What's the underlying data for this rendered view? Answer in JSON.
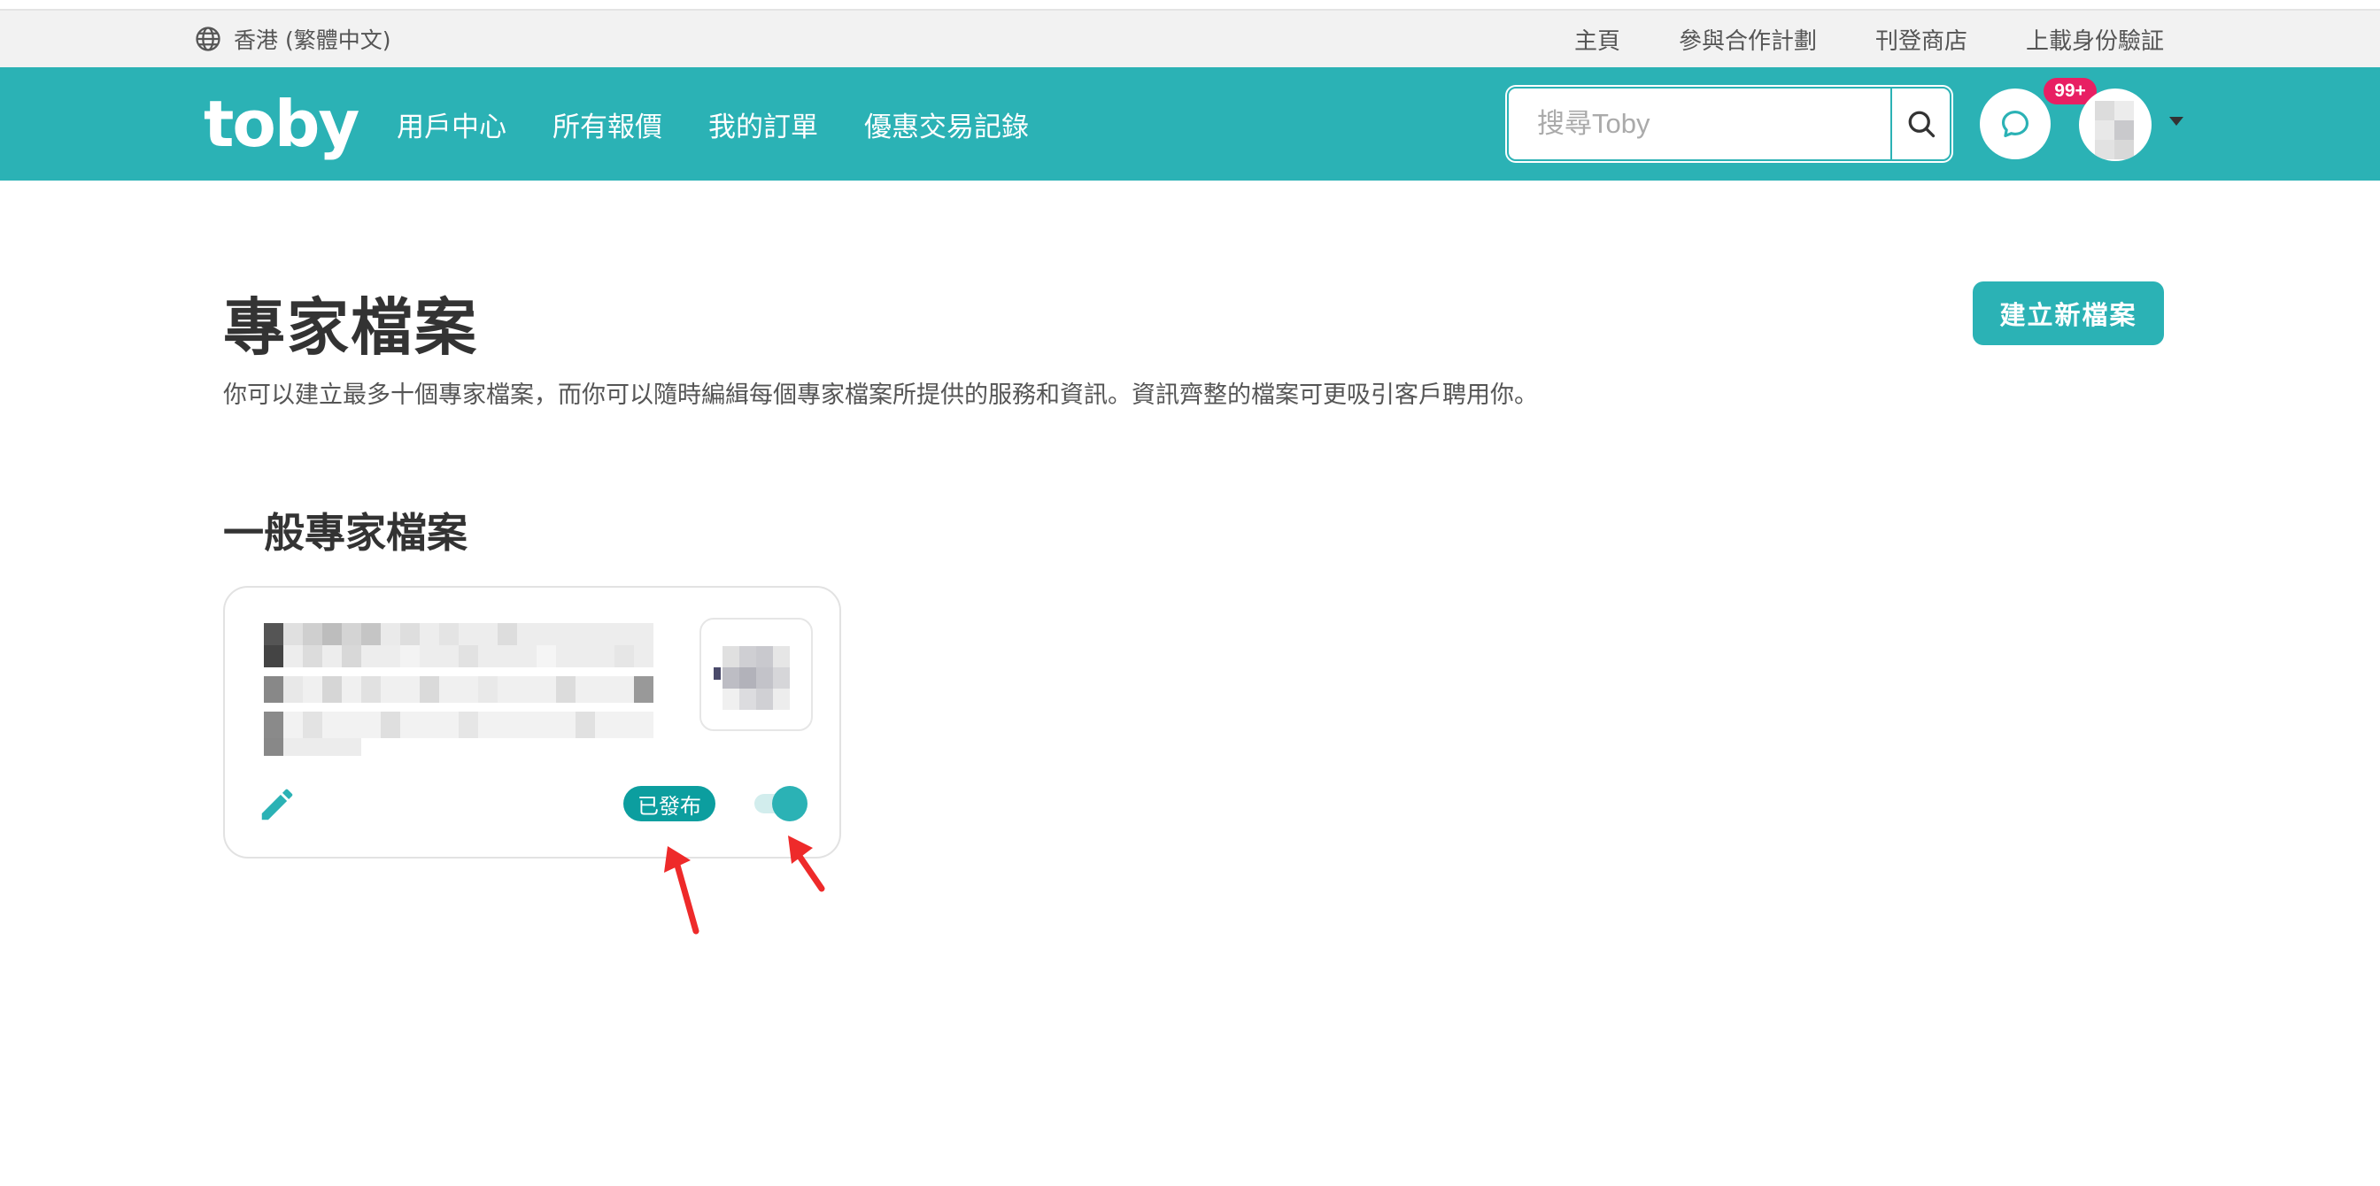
{
  "topbar": {
    "locale": "香港 (繁體中文)",
    "links": [
      "主頁",
      "參與合作計劃",
      "刊登商店",
      "上載身份驗証"
    ]
  },
  "navbar": {
    "logo": "toby",
    "links": [
      "用戶中心",
      "所有報價",
      "我的訂單",
      "優惠交易記錄"
    ],
    "search_placeholder": "搜尋Toby",
    "notification_count": "99+"
  },
  "main": {
    "title": "專家檔案",
    "description": "你可以建立最多十個專家檔案，而你可以隨時編緝每個專家檔案所提供的服務和資訊。資訊齊整的檔案可更吸引客戶聘用你。",
    "new_button": "建立新檔案",
    "section_title": "一般專家檔案",
    "card": {
      "status": "已發布",
      "published": true
    }
  },
  "colors": {
    "brand": "#2bb2b5",
    "badge": "#e81f63",
    "status": "#0c9e9f",
    "annotation_arrow": "#ee2a2a"
  }
}
